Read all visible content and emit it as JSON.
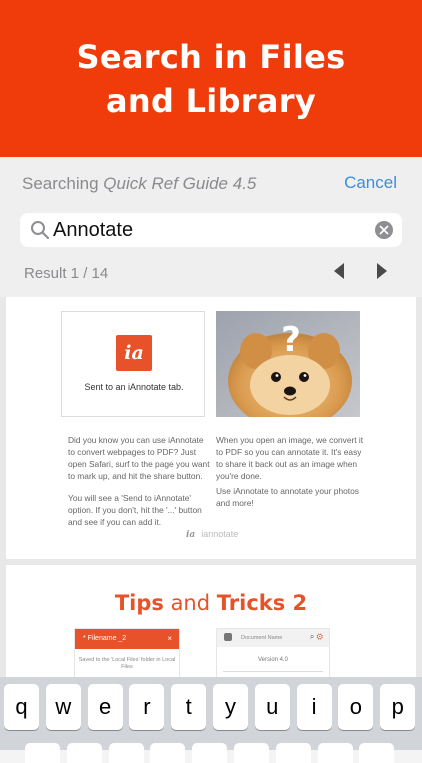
{
  "banner": {
    "title": "Search in Files\nand Library"
  },
  "search": {
    "searching_prefix": "Searching",
    "document_name": "Quick Ref Guide 4.5",
    "cancel_label": "Cancel",
    "query": "Annotate",
    "result_label": "Result 1 / 14"
  },
  "colors": {
    "accent": "#f03c0a",
    "link": "#3b8ede"
  },
  "document": {
    "page1": {
      "ia_logo": "ia",
      "ia_caption": "Sent to an iAnnotate tab.",
      "dog_question_mark": "?",
      "left_paragraph_1": "Did you know you can use iAnnotate to convert webpages to PDF? Just open Safari, surf to the page you want to mark up, and hit the share button.",
      "left_paragraph_2": "You will see a 'Send to iAnnotate' option. If you don't, hit the '...' button and see if you can add it.",
      "right_paragraph_1": "When you open an image, we convert it to PDF so you can annotate it. It's easy to share it back out as an image when you're done.",
      "right_paragraph_2": "Use iAnnotate to annotate your photos and more!",
      "footer_mark": "ia",
      "footer_text": "iannotate"
    },
    "page2": {
      "title_part1": "Tips",
      "title_and": " and ",
      "title_part2": "Tricks 2",
      "file_tab_title": "* Filename _2",
      "file_tab_close": "×",
      "file_tab_text": "Saved to the 'Local Files' folder in Local Files",
      "doc_name": "Document Name",
      "doc_version": "Version 4.0"
    }
  },
  "keyboard": {
    "row1": [
      "q",
      "w",
      "e",
      "r",
      "t",
      "y",
      "u",
      "i",
      "o",
      "p"
    ]
  }
}
